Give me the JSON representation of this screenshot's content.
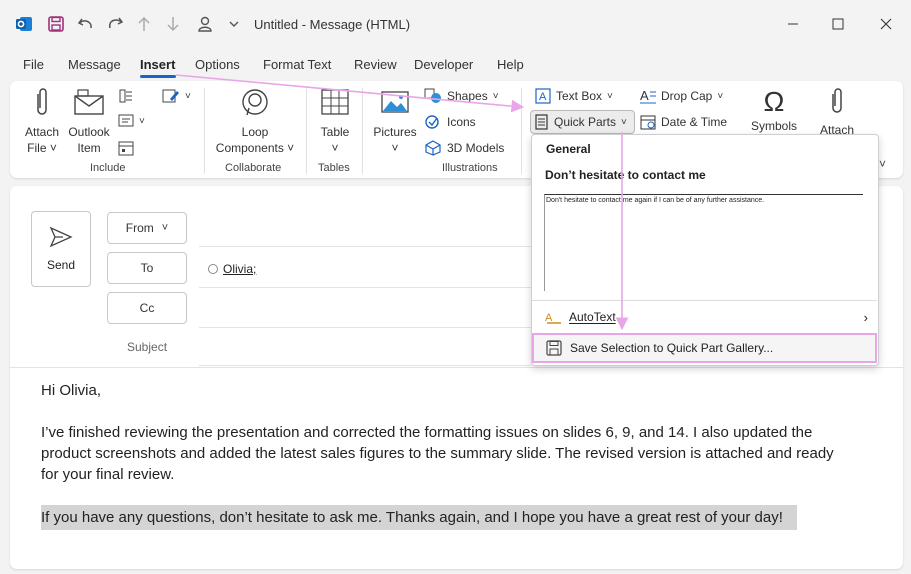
{
  "window": {
    "title": "Untitled  -  Message (HTML)"
  },
  "menu_tabs": [
    "File",
    "Message",
    "Insert",
    "Options",
    "Format Text",
    "Review",
    "Developer",
    "Help"
  ],
  "ribbon": {
    "include": {
      "attach_file": "Attach\nFile",
      "attach_file_l1": "Attach",
      "attach_file_l2": "File",
      "outlook_item_l1": "Outlook",
      "outlook_item_l2": "Item",
      "label": "Include"
    },
    "collaborate": {
      "loop_l1": "Loop",
      "loop_l2": "Components",
      "label": "Collaborate"
    },
    "tables": {
      "table": "Table",
      "label": "Tables"
    },
    "illustrations": {
      "pictures": "Pictures",
      "shapes": "Shapes",
      "icons": "Icons",
      "models": "3D Models",
      "label": "Illustrations"
    },
    "text": {
      "text_box": "Text Box",
      "quick_parts": "Quick Parts",
      "drop_cap": "Drop Cap",
      "date_time": "Date & Time"
    },
    "symbols": {
      "symbols": "Symbols",
      "attach": "Attach"
    }
  },
  "compose": {
    "send": "Send",
    "from": "From",
    "to": "To",
    "cc": "Cc",
    "subject": "Subject",
    "recipient": "Olivia;",
    "body": {
      "greeting": "Hi Olivia,",
      "p2_l1": "I’ve finished reviewing the presentation and corrected the formatting issues on slides 6, 9, and 14. I also updated the",
      "p2_l2": "product screenshots and added the latest sales figures to the summary slide. The revised version is attached and ready",
      "p2_l3": "for your final review.",
      "p3": "If you have any questions, don’t hesitate to ask me. Thanks again, and I hope you have a great rest of your day!"
    }
  },
  "quick_parts_menu": {
    "section": "General",
    "entry_name": "Don’t hesitate to contact me",
    "preview_text": "Don't hesitate to contact me again if I can be of any further assistance.",
    "autotext": "AutoText",
    "save_selection": "Save Selection to Quick Part Gallery..."
  },
  "colors": {
    "accent": "#1a63c9",
    "annotation": "#e8a6e8"
  }
}
